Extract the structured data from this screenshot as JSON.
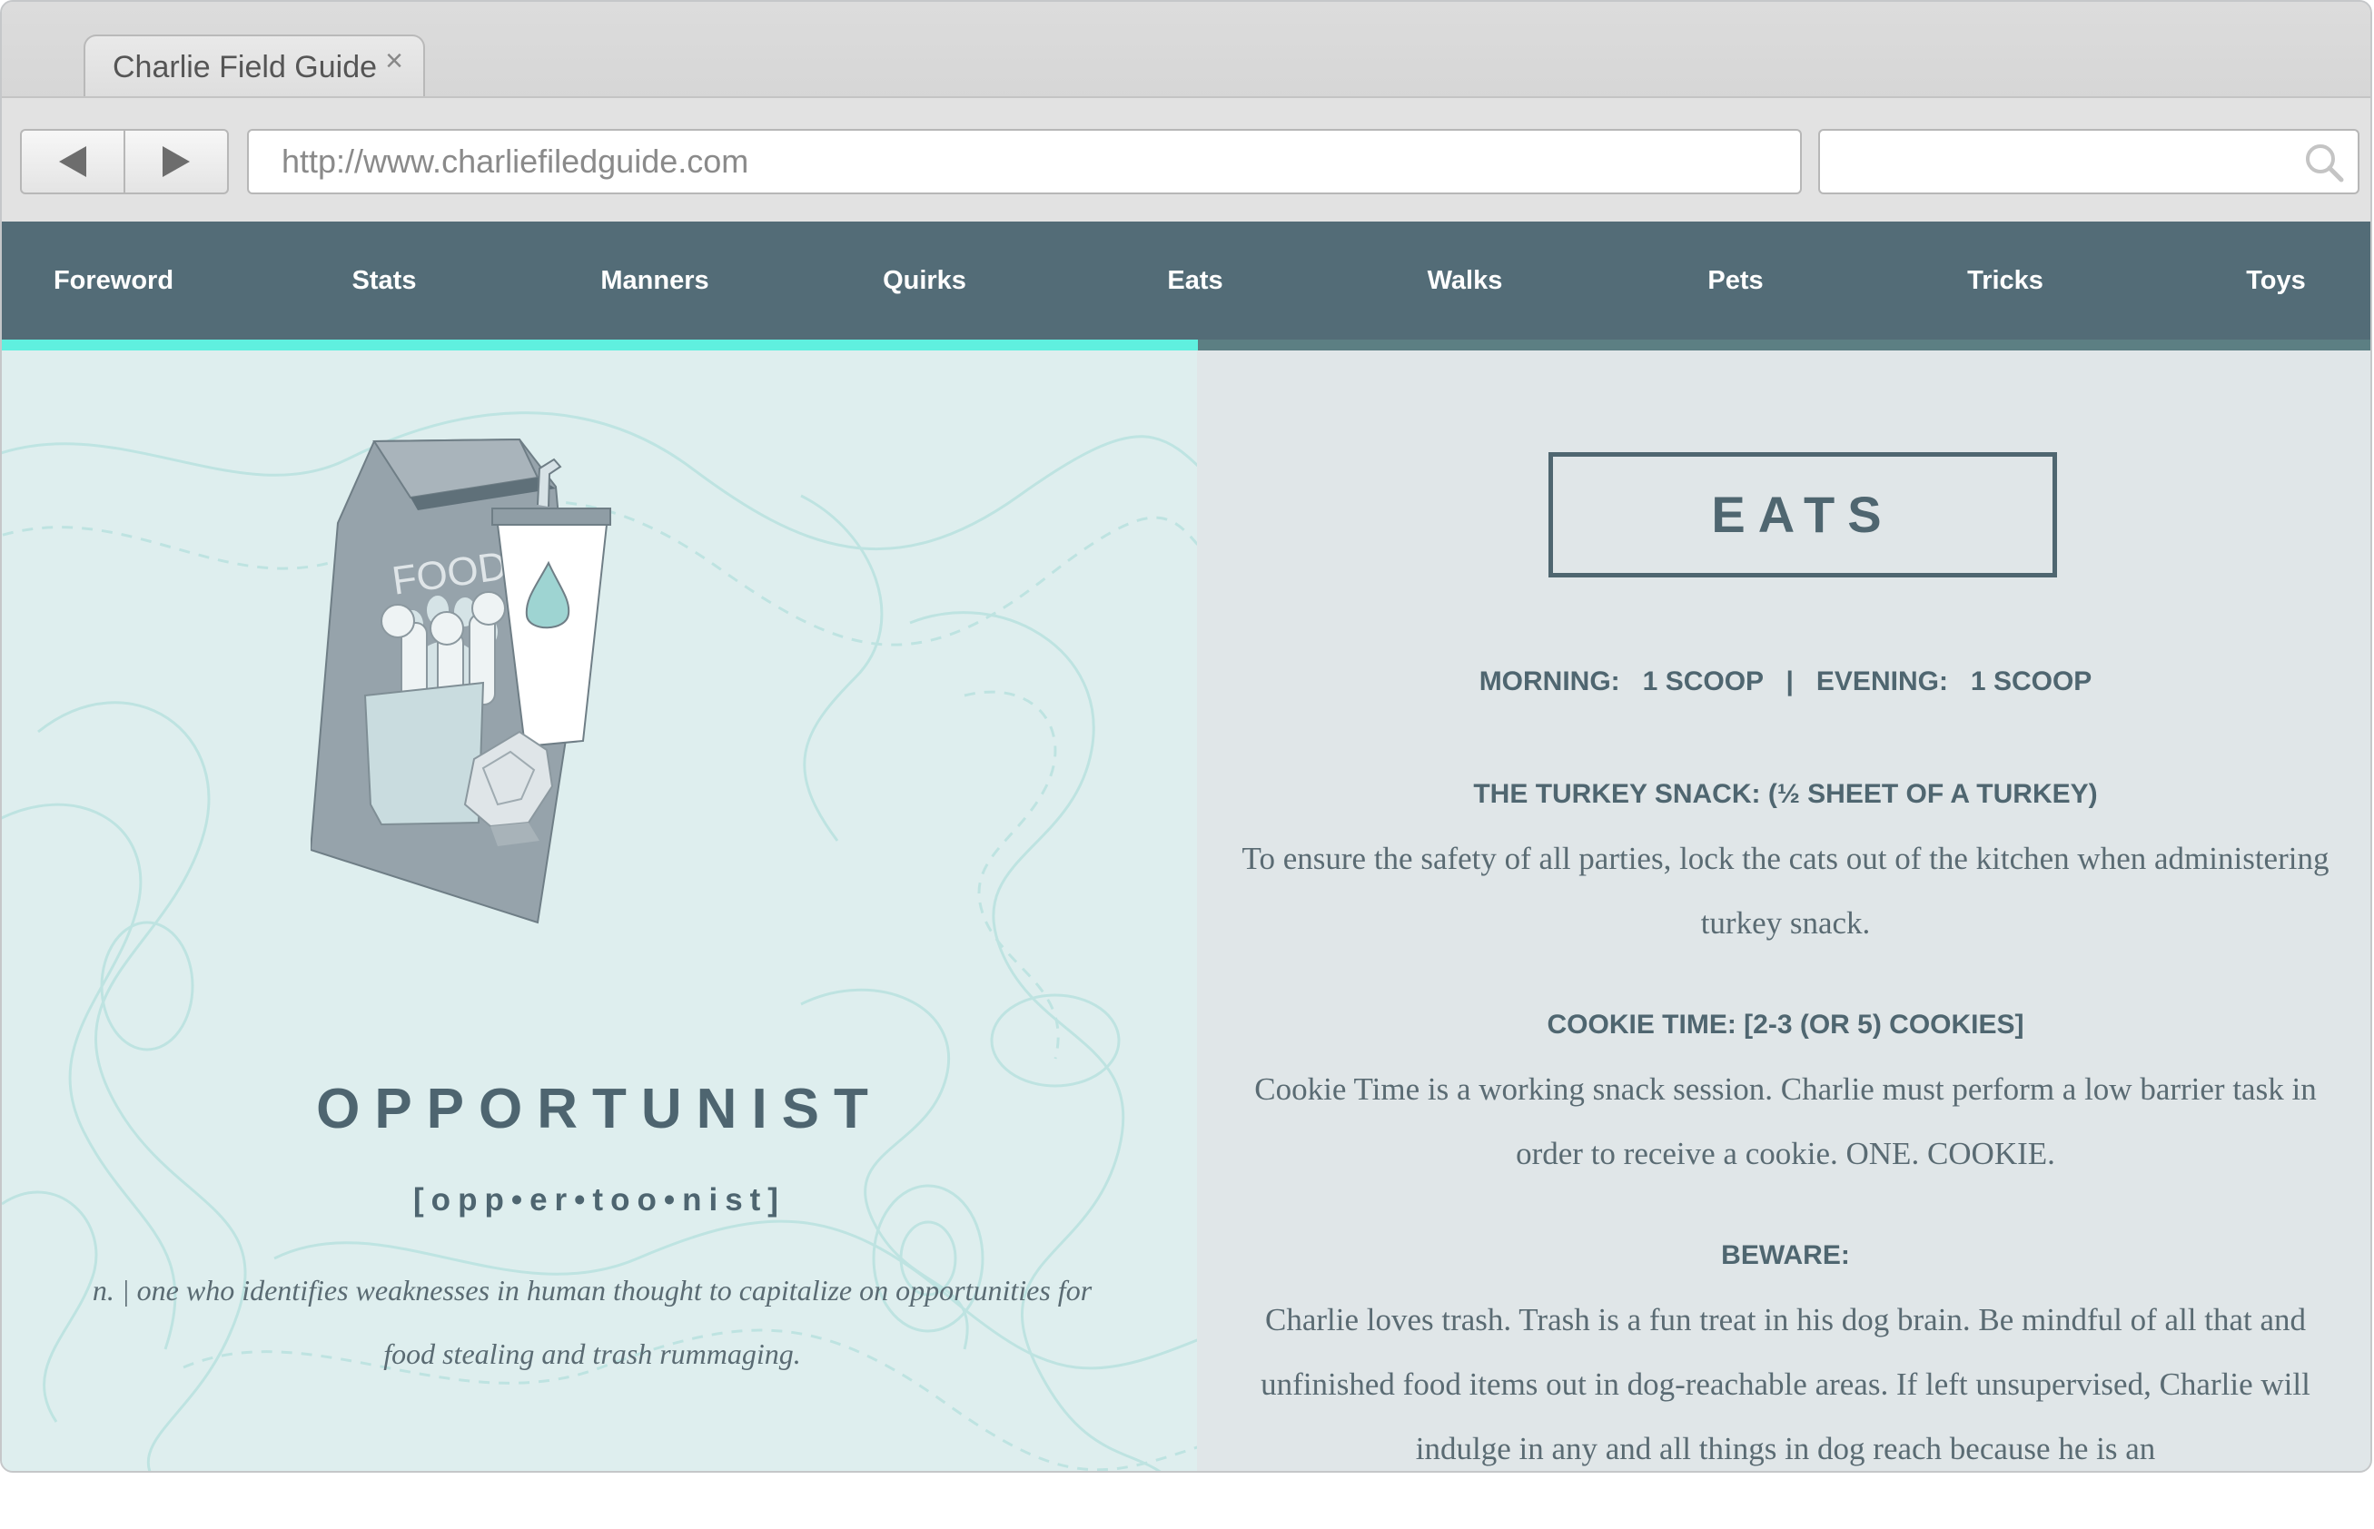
{
  "browser": {
    "tab_title": "Charlie Field Guide",
    "tab_close": "×",
    "url": "http://www.charliefiledguide.com"
  },
  "nav": {
    "items": [
      {
        "label": "Foreword"
      },
      {
        "label": "Stats"
      },
      {
        "label": "Manners"
      },
      {
        "label": "Quirks"
      },
      {
        "label": "Eats"
      },
      {
        "label": "Walks"
      },
      {
        "label": "Pets"
      },
      {
        "label": "Tricks"
      },
      {
        "label": "Toys"
      }
    ],
    "active": "Eats",
    "progress_fraction": 0.505
  },
  "left": {
    "illustration_text": "FOOD",
    "word": "OPPORTUNIST",
    "pronunciation": "[opp•er•too•nist]",
    "definition": "n. | one who identifies weaknesses in human thought to capitalize on opportunities for food stealing and trash rummaging."
  },
  "right": {
    "heading": "EATS",
    "feeding": "MORNING:   1 SCOOP   |   EVENING:   1 SCOOP",
    "sections": [
      {
        "title": "THE TURKEY SNACK: (½ SHEET OF A TURKEY)",
        "body": "To ensure the safety of all parties, lock the cats out of the kitchen when administering turkey snack."
      },
      {
        "title": "COOKIE TIME: [2-3 (OR 5) COOKIES]",
        "body": "Cookie Time is a working snack session. Charlie must perform a low barrier task in order to receive a cookie. ONE. COOKIE."
      },
      {
        "title": "BEWARE:",
        "body": "Charlie loves trash. Trash is a fun treat in his dog brain. Be mindful of all that and unfinished food items out in dog-reachable areas. If left unsupervised, Charlie will indulge in any and all things in dog reach because he is an"
      }
    ]
  },
  "colors": {
    "nav_bg": "#536c77",
    "accent": "#5ff0df",
    "left_bg": "#deeeee",
    "right_bg": "#e0e6e8",
    "heading": "#4f6670"
  }
}
